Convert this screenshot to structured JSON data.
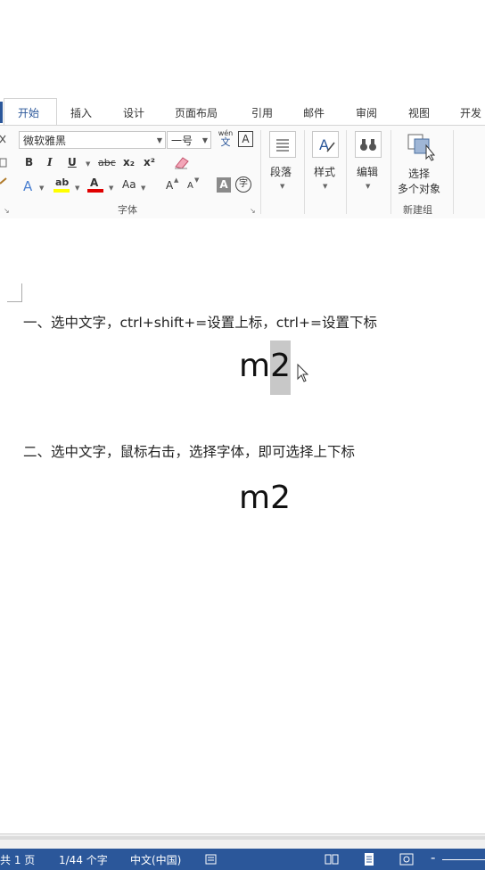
{
  "tabs": [
    "开始",
    "插入",
    "设计",
    "页面布局",
    "引用",
    "邮件",
    "审阅",
    "视图",
    "开发"
  ],
  "active_tab": "开始",
  "font": {
    "name": "微软雅黑",
    "size": "一号",
    "wen": "wén",
    "wen_char": "文",
    "a_box": "A",
    "bold": "B",
    "italic": "I",
    "underline": "U",
    "strike": "abc",
    "subscript": "x₂",
    "superscript": "x²",
    "text_effect": "A",
    "highlight": "ab",
    "font_color": "A",
    "change_case": "Aa",
    "grow": "A",
    "shrink": "A",
    "shading": "A",
    "enclose": "字",
    "group_label": "字体"
  },
  "groups": {
    "paragraph": "段落",
    "styles": "样式",
    "editing": "编辑",
    "select_line1": "选择",
    "select_line2": "多个对象",
    "new_group": "新建组"
  },
  "document": {
    "line1": "一、选中文字，ctrl+shift+=设置上标，ctrl+=设置下标",
    "m2_first_m": "m",
    "m2_first_2": "2",
    "line2": "二、选中文字，鼠标右击，选择字体，即可选择上下标",
    "m2_second": "m2"
  },
  "status": {
    "pages": "共 1 页",
    "words": "1/44 个字",
    "language": "中文(中国)"
  },
  "colors": {
    "accent": "#2b579a",
    "highlight_yellow": "#ffff00",
    "font_red": "#e00000",
    "selection_gray": "#c8c8c8"
  }
}
